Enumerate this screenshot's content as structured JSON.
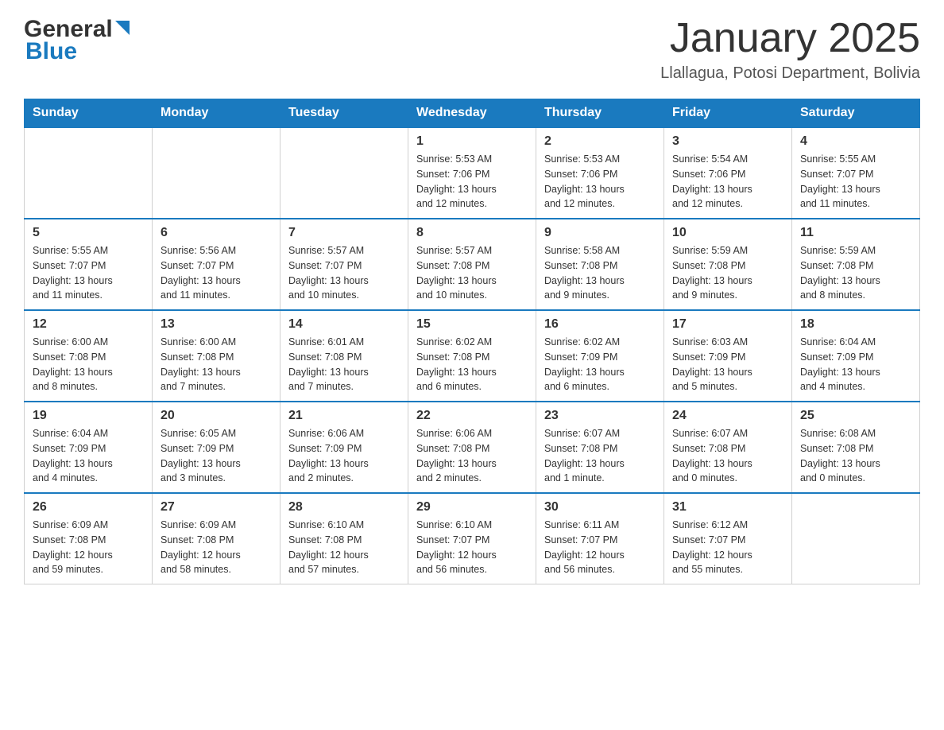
{
  "header": {
    "logo_general": "General",
    "logo_blue": "Blue",
    "month_title": "January 2025",
    "location": "Llallagua, Potosi Department, Bolivia"
  },
  "days_of_week": [
    "Sunday",
    "Monday",
    "Tuesday",
    "Wednesday",
    "Thursday",
    "Friday",
    "Saturday"
  ],
  "weeks": [
    [
      {
        "day": "",
        "info": ""
      },
      {
        "day": "",
        "info": ""
      },
      {
        "day": "",
        "info": ""
      },
      {
        "day": "1",
        "info": "Sunrise: 5:53 AM\nSunset: 7:06 PM\nDaylight: 13 hours\nand 12 minutes."
      },
      {
        "day": "2",
        "info": "Sunrise: 5:53 AM\nSunset: 7:06 PM\nDaylight: 13 hours\nand 12 minutes."
      },
      {
        "day": "3",
        "info": "Sunrise: 5:54 AM\nSunset: 7:06 PM\nDaylight: 13 hours\nand 12 minutes."
      },
      {
        "day": "4",
        "info": "Sunrise: 5:55 AM\nSunset: 7:07 PM\nDaylight: 13 hours\nand 11 minutes."
      }
    ],
    [
      {
        "day": "5",
        "info": "Sunrise: 5:55 AM\nSunset: 7:07 PM\nDaylight: 13 hours\nand 11 minutes."
      },
      {
        "day": "6",
        "info": "Sunrise: 5:56 AM\nSunset: 7:07 PM\nDaylight: 13 hours\nand 11 minutes."
      },
      {
        "day": "7",
        "info": "Sunrise: 5:57 AM\nSunset: 7:07 PM\nDaylight: 13 hours\nand 10 minutes."
      },
      {
        "day": "8",
        "info": "Sunrise: 5:57 AM\nSunset: 7:08 PM\nDaylight: 13 hours\nand 10 minutes."
      },
      {
        "day": "9",
        "info": "Sunrise: 5:58 AM\nSunset: 7:08 PM\nDaylight: 13 hours\nand 9 minutes."
      },
      {
        "day": "10",
        "info": "Sunrise: 5:59 AM\nSunset: 7:08 PM\nDaylight: 13 hours\nand 9 minutes."
      },
      {
        "day": "11",
        "info": "Sunrise: 5:59 AM\nSunset: 7:08 PM\nDaylight: 13 hours\nand 8 minutes."
      }
    ],
    [
      {
        "day": "12",
        "info": "Sunrise: 6:00 AM\nSunset: 7:08 PM\nDaylight: 13 hours\nand 8 minutes."
      },
      {
        "day": "13",
        "info": "Sunrise: 6:00 AM\nSunset: 7:08 PM\nDaylight: 13 hours\nand 7 minutes."
      },
      {
        "day": "14",
        "info": "Sunrise: 6:01 AM\nSunset: 7:08 PM\nDaylight: 13 hours\nand 7 minutes."
      },
      {
        "day": "15",
        "info": "Sunrise: 6:02 AM\nSunset: 7:08 PM\nDaylight: 13 hours\nand 6 minutes."
      },
      {
        "day": "16",
        "info": "Sunrise: 6:02 AM\nSunset: 7:09 PM\nDaylight: 13 hours\nand 6 minutes."
      },
      {
        "day": "17",
        "info": "Sunrise: 6:03 AM\nSunset: 7:09 PM\nDaylight: 13 hours\nand 5 minutes."
      },
      {
        "day": "18",
        "info": "Sunrise: 6:04 AM\nSunset: 7:09 PM\nDaylight: 13 hours\nand 4 minutes."
      }
    ],
    [
      {
        "day": "19",
        "info": "Sunrise: 6:04 AM\nSunset: 7:09 PM\nDaylight: 13 hours\nand 4 minutes."
      },
      {
        "day": "20",
        "info": "Sunrise: 6:05 AM\nSunset: 7:09 PM\nDaylight: 13 hours\nand 3 minutes."
      },
      {
        "day": "21",
        "info": "Sunrise: 6:06 AM\nSunset: 7:09 PM\nDaylight: 13 hours\nand 2 minutes."
      },
      {
        "day": "22",
        "info": "Sunrise: 6:06 AM\nSunset: 7:08 PM\nDaylight: 13 hours\nand 2 minutes."
      },
      {
        "day": "23",
        "info": "Sunrise: 6:07 AM\nSunset: 7:08 PM\nDaylight: 13 hours\nand 1 minute."
      },
      {
        "day": "24",
        "info": "Sunrise: 6:07 AM\nSunset: 7:08 PM\nDaylight: 13 hours\nand 0 minutes."
      },
      {
        "day": "25",
        "info": "Sunrise: 6:08 AM\nSunset: 7:08 PM\nDaylight: 13 hours\nand 0 minutes."
      }
    ],
    [
      {
        "day": "26",
        "info": "Sunrise: 6:09 AM\nSunset: 7:08 PM\nDaylight: 12 hours\nand 59 minutes."
      },
      {
        "day": "27",
        "info": "Sunrise: 6:09 AM\nSunset: 7:08 PM\nDaylight: 12 hours\nand 58 minutes."
      },
      {
        "day": "28",
        "info": "Sunrise: 6:10 AM\nSunset: 7:08 PM\nDaylight: 12 hours\nand 57 minutes."
      },
      {
        "day": "29",
        "info": "Sunrise: 6:10 AM\nSunset: 7:07 PM\nDaylight: 12 hours\nand 56 minutes."
      },
      {
        "day": "30",
        "info": "Sunrise: 6:11 AM\nSunset: 7:07 PM\nDaylight: 12 hours\nand 56 minutes."
      },
      {
        "day": "31",
        "info": "Sunrise: 6:12 AM\nSunset: 7:07 PM\nDaylight: 12 hours\nand 55 minutes."
      },
      {
        "day": "",
        "info": ""
      }
    ]
  ]
}
